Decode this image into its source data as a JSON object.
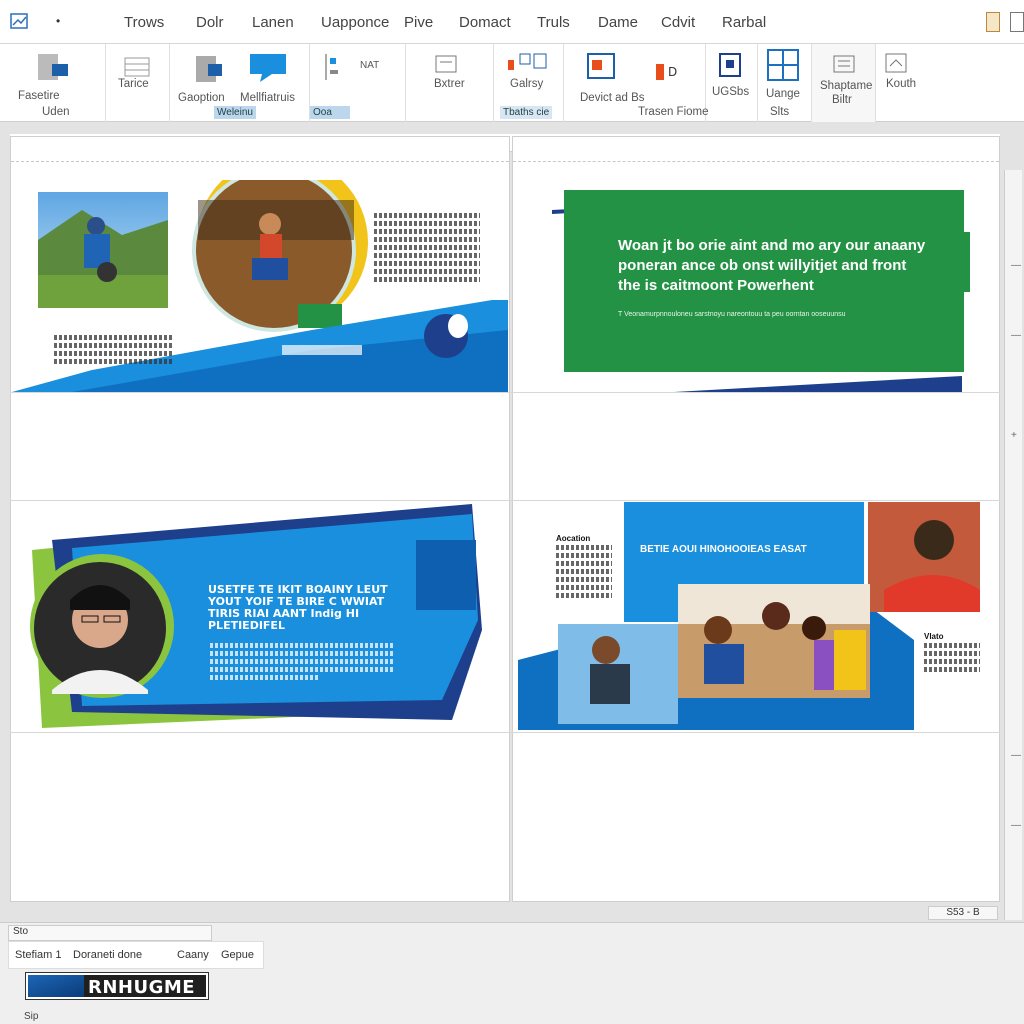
{
  "menubar": {
    "items": [
      "Trows",
      "Dolr",
      "Lanen",
      "Uapponce",
      "Pive",
      "Domact",
      "Truls",
      "Dame",
      "Cdvit",
      "Rarbal"
    ]
  },
  "ribbon": {
    "groups": [
      {
        "label_1": "Fasetire",
        "label_2": "Uden"
      },
      {
        "label": "Tarice"
      },
      {
        "label_1": "Gaoption",
        "label_2": "Weleinu",
        "chip": "Weleinu"
      },
      {
        "label": "Mellfiatruis"
      },
      {
        "label": "NAT",
        "chip": "Ooa"
      },
      {
        "label": "Bxtrer"
      },
      {
        "label": "Galrsy"
      },
      {
        "label": "Devict ad Bs",
        "sub": "Trasen Fiome",
        "chip": "Tbaths cie"
      },
      {
        "label": "UGSbs"
      },
      {
        "label_1": "Uange",
        "label_2": "Slts"
      },
      {
        "label_1": "Shaptame",
        "label_2": "Biltr"
      },
      {
        "label": "Kouth"
      }
    ]
  },
  "slides": {
    "s2_title": "Woan jt bo orie aint and mo ary our anaany poneran ance ob onst willyitjet and front the is caitmoont Powerhent",
    "s2_sub": "T Veonamurpnnouloneu sarstnoyu nareontouu ta peu oorntan ooseuunsu",
    "s3_title": "USETFE TE IKIT BOAINY LEUT YOUT YOIF TE BIRE C WWIAT TIRIS RIAI AANT Indig HI PLETIEDIFEL",
    "s4_heading": "BETIE AOUI HINOHOOIEAS EASAT",
    "s4_side": "Aocation",
    "s4_side2": "Vlato"
  },
  "status": {
    "tab": "Sto",
    "label_1": "Stefiam 1",
    "label_2": "Doraneti done",
    "label_3": "Caany",
    "label_4": "Gepue",
    "logo_text": "RNHUGME",
    "footer": "Sip",
    "zoom": "S53 - B"
  },
  "colors": {
    "accent_blue": "#1a8fdd",
    "navy": "#1d3f8c",
    "green": "#239245",
    "lime": "#8bc53f"
  }
}
